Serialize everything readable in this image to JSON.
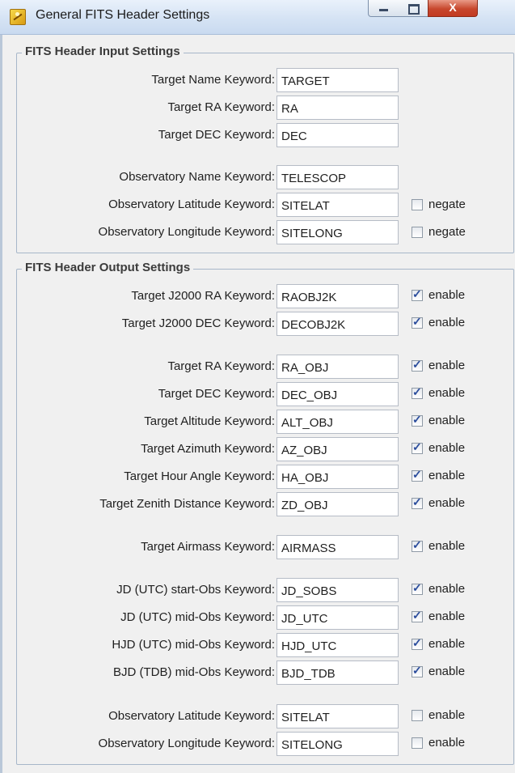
{
  "window": {
    "title": "General FITS Header Settings",
    "close_label": "X"
  },
  "input_settings": {
    "title": "FITS Header Input Settings",
    "rows": [
      {
        "label": "Target Name Keyword:",
        "value": "TARGET"
      },
      {
        "label": "Target RA Keyword:",
        "value": "RA"
      },
      {
        "label": "Target DEC Keyword:",
        "value": "DEC"
      },
      {
        "label": "Observatory Name Keyword:",
        "value": "TELESCOP"
      },
      {
        "label": "Observatory Latitude Keyword:",
        "value": "SITELAT",
        "option": "negate",
        "checked": false
      },
      {
        "label": "Observatory Longitude Keyword:",
        "value": "SITELONG",
        "option": "negate",
        "checked": false
      }
    ]
  },
  "output_settings": {
    "title": "FITS Header Output Settings",
    "rows": [
      {
        "label": "Target J2000 RA Keyword:",
        "value": "RAOBJ2K",
        "option": "enable",
        "checked": true
      },
      {
        "label": "Target J2000 DEC Keyword:",
        "value": "DECOBJ2K",
        "option": "enable",
        "checked": true
      },
      {
        "label": "Target RA Keyword:",
        "value": "RA_OBJ",
        "option": "enable",
        "checked": true
      },
      {
        "label": "Target DEC Keyword:",
        "value": "DEC_OBJ",
        "option": "enable",
        "checked": true
      },
      {
        "label": "Target Altitude Keyword:",
        "value": "ALT_OBJ",
        "option": "enable",
        "checked": true
      },
      {
        "label": "Target Azimuth Keyword:",
        "value": "AZ_OBJ",
        "option": "enable",
        "checked": true
      },
      {
        "label": "Target Hour Angle Keyword:",
        "value": "HA_OBJ",
        "option": "enable",
        "checked": true
      },
      {
        "label": "Target Zenith Distance Keyword:",
        "value": "ZD_OBJ",
        "option": "enable",
        "checked": true
      },
      {
        "label": "Target Airmass Keyword:",
        "value": "AIRMASS",
        "option": "enable",
        "checked": true
      },
      {
        "label": "JD (UTC) start-Obs Keyword:",
        "value": "JD_SOBS",
        "option": "enable",
        "checked": true
      },
      {
        "label": "JD (UTC) mid-Obs Keyword:",
        "value": "JD_UTC",
        "option": "enable",
        "checked": true
      },
      {
        "label": "HJD (UTC) mid-Obs Keyword:",
        "value": "HJD_UTC",
        "option": "enable",
        "checked": true
      },
      {
        "label": "BJD (TDB) mid-Obs Keyword:",
        "value": "BJD_TDB",
        "option": "enable",
        "checked": true
      },
      {
        "label": "Observatory Latitude Keyword:",
        "value": "SITELAT",
        "option": "enable",
        "checked": false
      },
      {
        "label": "Observatory Longitude Keyword:",
        "value": "SITELONG",
        "option": "enable",
        "checked": false
      }
    ]
  }
}
